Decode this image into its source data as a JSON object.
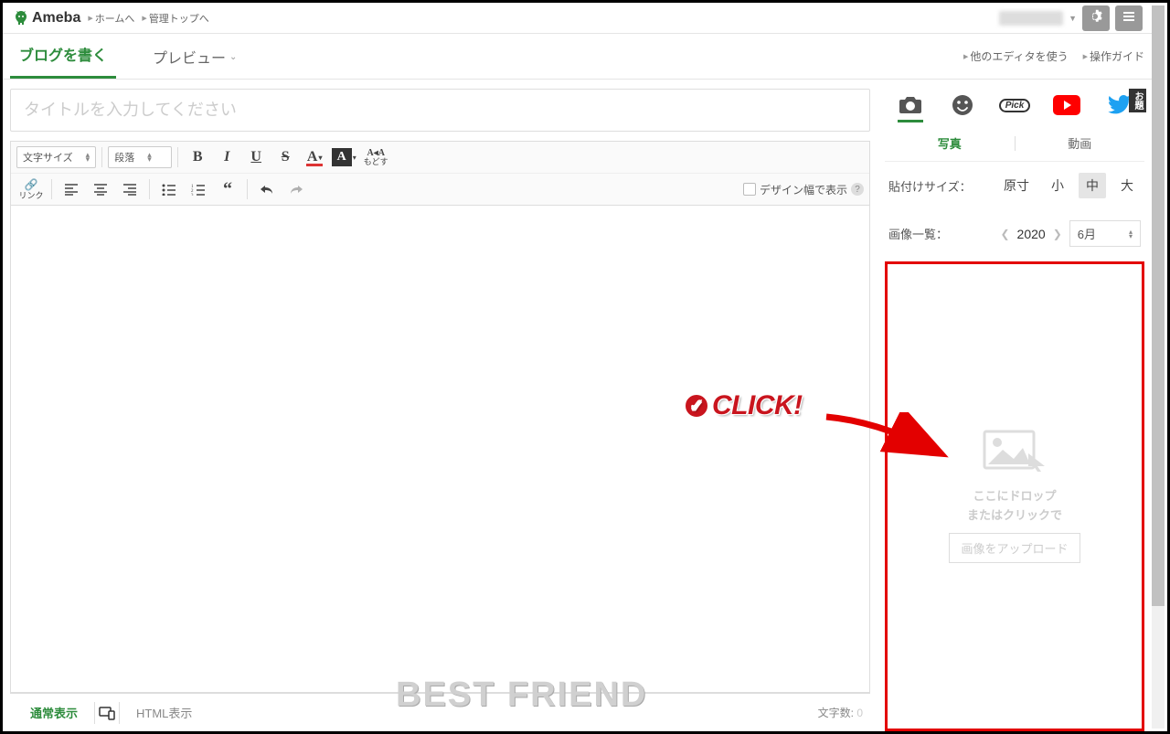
{
  "header": {
    "brand": "Ameba",
    "home_link": "ホームへ",
    "admin_link": "管理トップへ"
  },
  "tabs": {
    "write": "ブログを書く",
    "preview": "プレビュー",
    "other_editor": "他のエディタを使う",
    "guide": "操作ガイド"
  },
  "editor": {
    "title_placeholder": "タイトルを入力してください",
    "font_size_label": "文字サイズ",
    "block_label": "段落",
    "link_label": "リンク",
    "reset_label": "もどす",
    "reset_top": "A◂A",
    "design_width_label": "デザイン幅で表示"
  },
  "footer": {
    "normal_view": "通常表示",
    "html_view": "HTML表示",
    "char_count_label": "文字数:",
    "char_count_value": "0"
  },
  "side": {
    "pick_label": "Pick",
    "odai_label": "お題",
    "tab_photo": "写真",
    "tab_video": "動画",
    "size_label": "貼付けサイズ：",
    "size_opts": {
      "orig": "原寸",
      "small": "小",
      "medium": "中",
      "large": "大"
    },
    "list_label": "画像一覧：",
    "year": "2020",
    "month": "6月",
    "drop_line1": "ここにドロップ",
    "drop_line2": "またはクリックで",
    "upload_btn": "画像をアップロード"
  },
  "callout": {
    "text": "CLICK!"
  },
  "watermark": "BEST  FRIEND"
}
